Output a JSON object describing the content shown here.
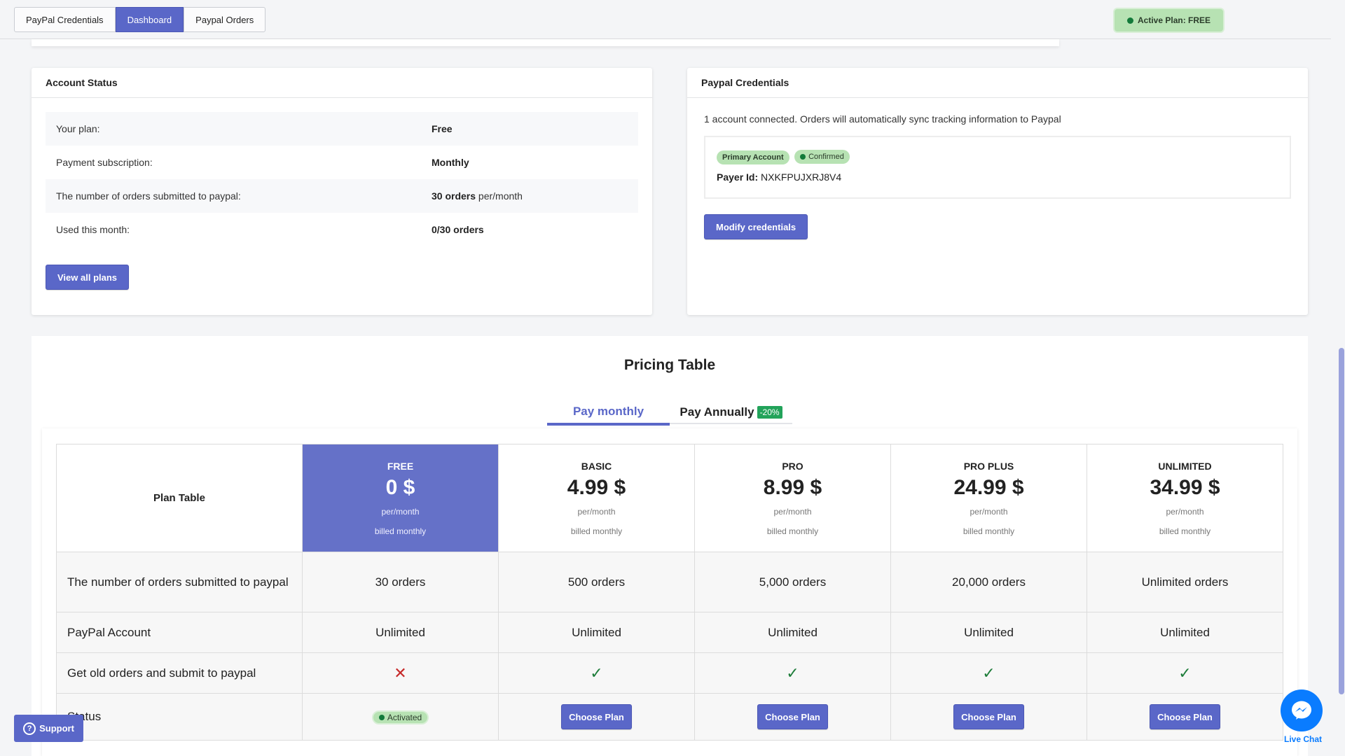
{
  "nav": {
    "tabs": [
      {
        "label": "PayPal Credentials",
        "active": false
      },
      {
        "label": "Dashboard",
        "active": true
      },
      {
        "label": "Paypal Orders",
        "active": false
      }
    ],
    "active_plan": "Active Plan:  FREE"
  },
  "account_status": {
    "title": "Account Status",
    "rows": [
      {
        "label": "Your plan:",
        "value_bold": "Free",
        "value_rest": ""
      },
      {
        "label": "Payment subscription:",
        "value_bold": "Monthly",
        "value_rest": ""
      },
      {
        "label": "The number of orders submitted to paypal:",
        "value_bold": "30 orders",
        "value_rest": " per/month"
      },
      {
        "label": "Used this month:",
        "value_bold": "0/30 orders",
        "value_rest": ""
      }
    ],
    "view_all_plans": "View all plans"
  },
  "paypal_credentials": {
    "title": "Paypal Credentials",
    "description": "1 account connected. Orders will automatically sync tracking information to Paypal",
    "badges": {
      "primary": "Primary Account",
      "confirmed": "Confirmed"
    },
    "payer_label": "Payer Id:",
    "payer_id": "NXKFPUJXRJ8V4",
    "modify_button": "Modify credentials"
  },
  "pricing": {
    "title": "Pricing Table",
    "toggle": {
      "monthly": "Pay monthly",
      "annually": "Pay Annually",
      "discount": "-20%"
    },
    "table_label": "Plan Table",
    "plans": [
      {
        "name": "FREE",
        "price": "0 $",
        "period": "per/month",
        "billing": "billed monthly",
        "orders": "30 orders",
        "paypal_account": "Unlimited",
        "old_orders": false,
        "status": "Activated"
      },
      {
        "name": "BASIC",
        "price": "4.99 $",
        "period": "per/month",
        "billing": "billed monthly",
        "orders": "500 orders",
        "paypal_account": "Unlimited",
        "old_orders": true,
        "status": "Choose Plan"
      },
      {
        "name": "PRO",
        "price": "8.99 $",
        "period": "per/month",
        "billing": "billed monthly",
        "orders": "5,000 orders",
        "paypal_account": "Unlimited",
        "old_orders": true,
        "status": "Choose Plan"
      },
      {
        "name": "PRO PLUS",
        "price": "24.99 $",
        "period": "per/month",
        "billing": "billed monthly",
        "orders": "20,000 orders",
        "paypal_account": "Unlimited",
        "old_orders": true,
        "status": "Choose Plan"
      },
      {
        "name": "UNLIMITED",
        "price": "34.99 $",
        "period": "per/month",
        "billing": "billed monthly",
        "orders": "Unlimited orders",
        "paypal_account": "Unlimited",
        "old_orders": true,
        "status": "Choose Plan"
      }
    ],
    "features": {
      "orders": "The number of orders submitted to paypal",
      "paypal_account": "PayPal Account",
      "old_orders": "Get old orders and submit to paypal",
      "status": "Status"
    },
    "icons": {
      "yes": "check-icon",
      "no": "cross-icon"
    }
  },
  "floating": {
    "support": "Support",
    "live_chat": "Live Chat"
  },
  "colors": {
    "accent": "#5a67c8",
    "featured": "#6571c8",
    "success_badge": "#b7e2b3",
    "discount": "#22a35a",
    "messenger": "#0a7cff"
  }
}
